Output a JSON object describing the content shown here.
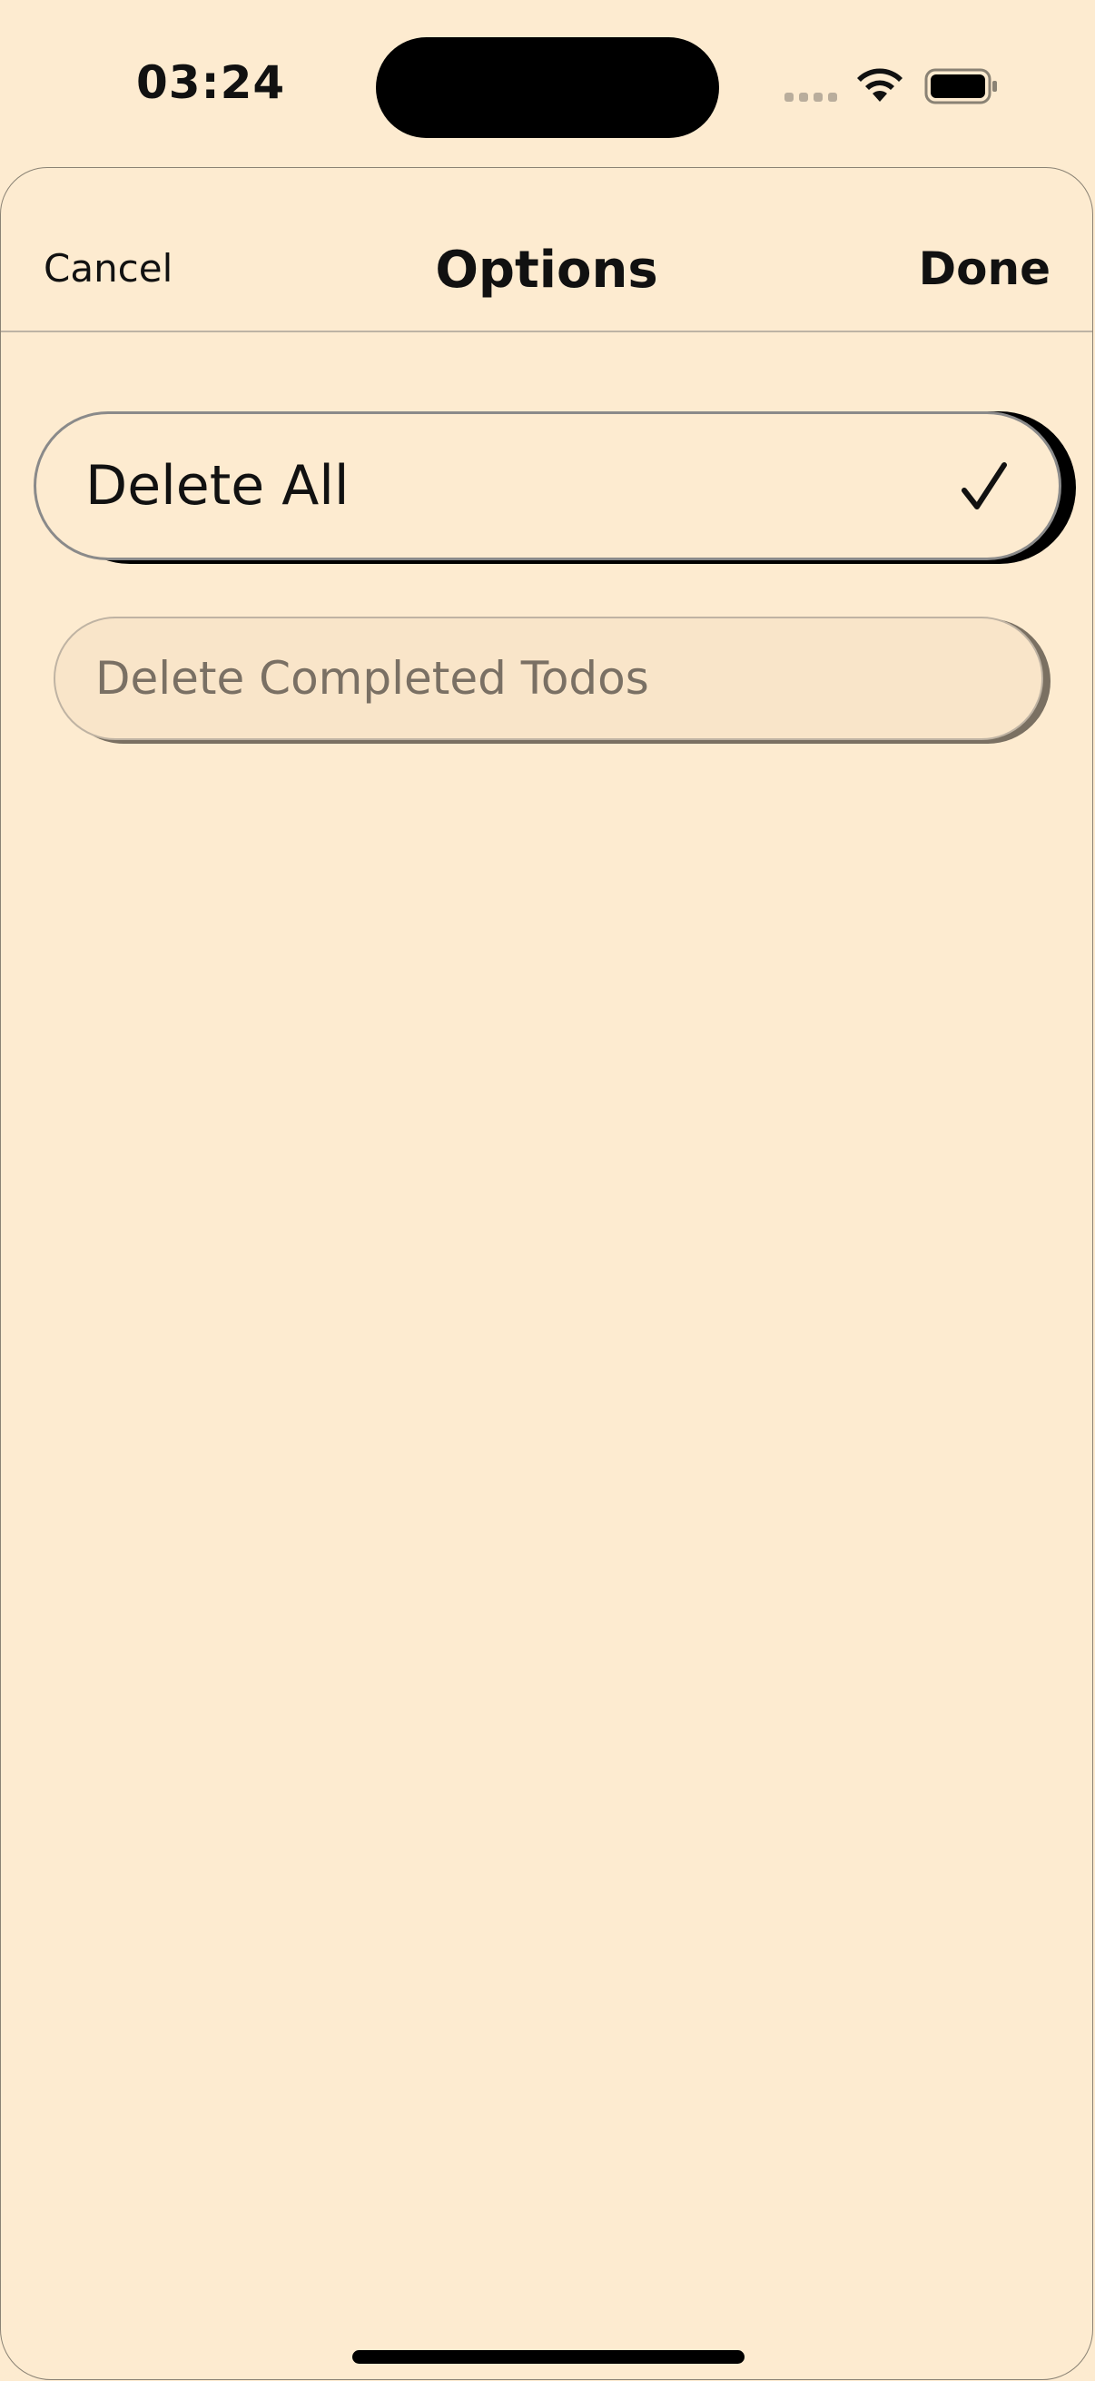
{
  "status_bar": {
    "time": "03:24",
    "icons": [
      "cellular-signal-icon",
      "wifi-icon",
      "battery-icon"
    ]
  },
  "nav": {
    "cancel_label": "Cancel",
    "title": "Options",
    "done_label": "Done"
  },
  "options": [
    {
      "label": "Delete All",
      "selected": true,
      "icon": "checkmark-icon"
    },
    {
      "label": "Delete Completed Todos",
      "selected": false
    }
  ],
  "colors": {
    "background": "#fdebd0",
    "text": "#111111",
    "disabled_text": "#7a7064",
    "selected_shadow": "#000000",
    "unselected_face": "#f9e5c9"
  }
}
